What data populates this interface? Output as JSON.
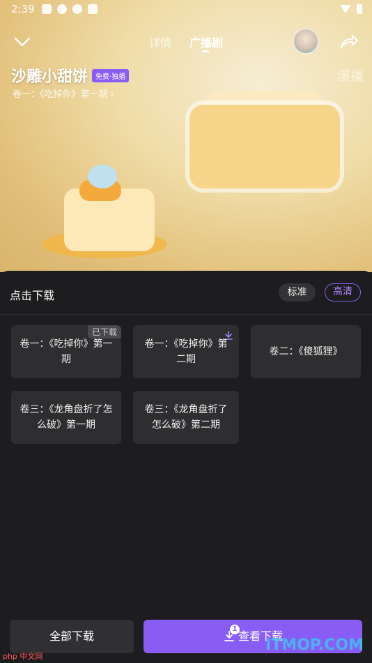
{
  "status": {
    "time": "2:39"
  },
  "nav": {
    "tabs": [
      {
        "label": "详情"
      },
      {
        "label": "广播剧"
      }
    ]
  },
  "show": {
    "title": "沙雕小甜饼",
    "badge": "免费·独播",
    "subtitle": "卷一：《吃掉你》第一期 ›",
    "side_text": "漫播"
  },
  "sheet": {
    "title": "点击下载",
    "quality_std": "标准",
    "quality_hd": "高清",
    "episodes": [
      {
        "label": "卷一：《吃掉你》第一期",
        "tag": "已下载"
      },
      {
        "label": "卷一：《吃掉你》第二期"
      },
      {
        "label": "卷二：《傻狐狸》"
      },
      {
        "label": "卷三：《龙角盘折了怎么破》第一期"
      },
      {
        "label": "卷三：《龙角盘折了怎么破》第二期"
      }
    ]
  },
  "actions": {
    "download_all": "全部下载",
    "view_downloads": "查看下载",
    "downloads_count": "1"
  },
  "watermarks": {
    "left": "php 中文网",
    "right": "ITMOP.COM"
  },
  "colors": {
    "accent": "#8a5cf6",
    "sheet_bg": "#1d1c1e",
    "card_bg": "#2e2d30"
  }
}
